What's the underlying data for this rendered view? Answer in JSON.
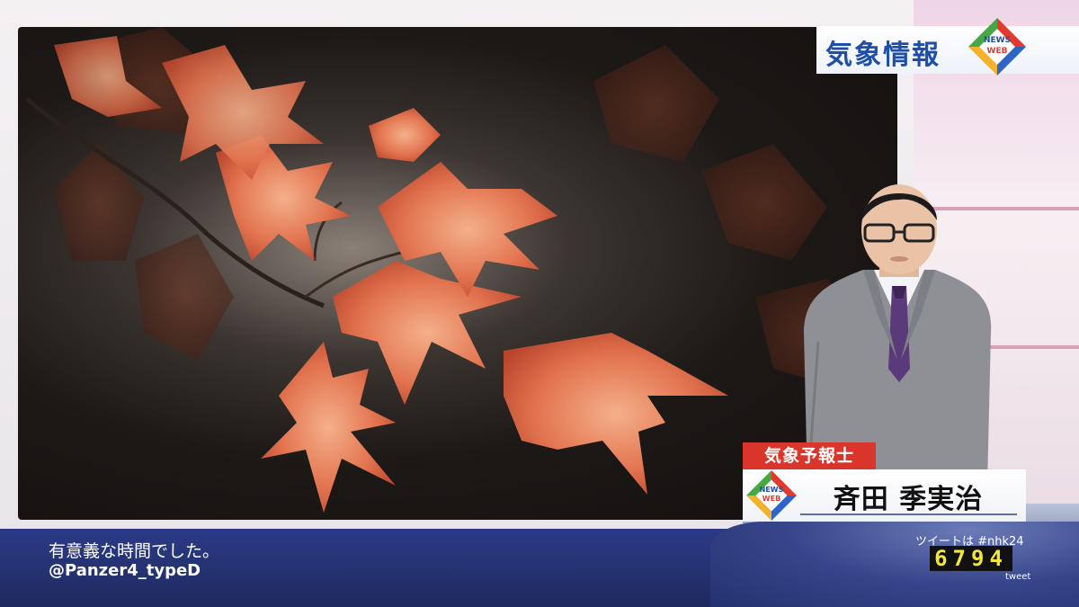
{
  "segment": {
    "title": "気象情報",
    "logo_text_top": "NEWS",
    "logo_text_bottom": "WEB"
  },
  "caption": {
    "role": "気象予報士",
    "name": "斉田 季実治",
    "logo_text_top": "NEWS",
    "logo_text_bottom": "WEB"
  },
  "tweet": {
    "message": "有意義な時間でした。",
    "handle": "@Panzer4_typeD",
    "hint": "ツイートは #nhk24",
    "count": "6794",
    "label": "tweet"
  },
  "colors": {
    "brand_blue": "#1d4fa8",
    "role_red": "#d9352a",
    "band_navy": "#24316f",
    "counter_yellow": "#f2e63a"
  }
}
